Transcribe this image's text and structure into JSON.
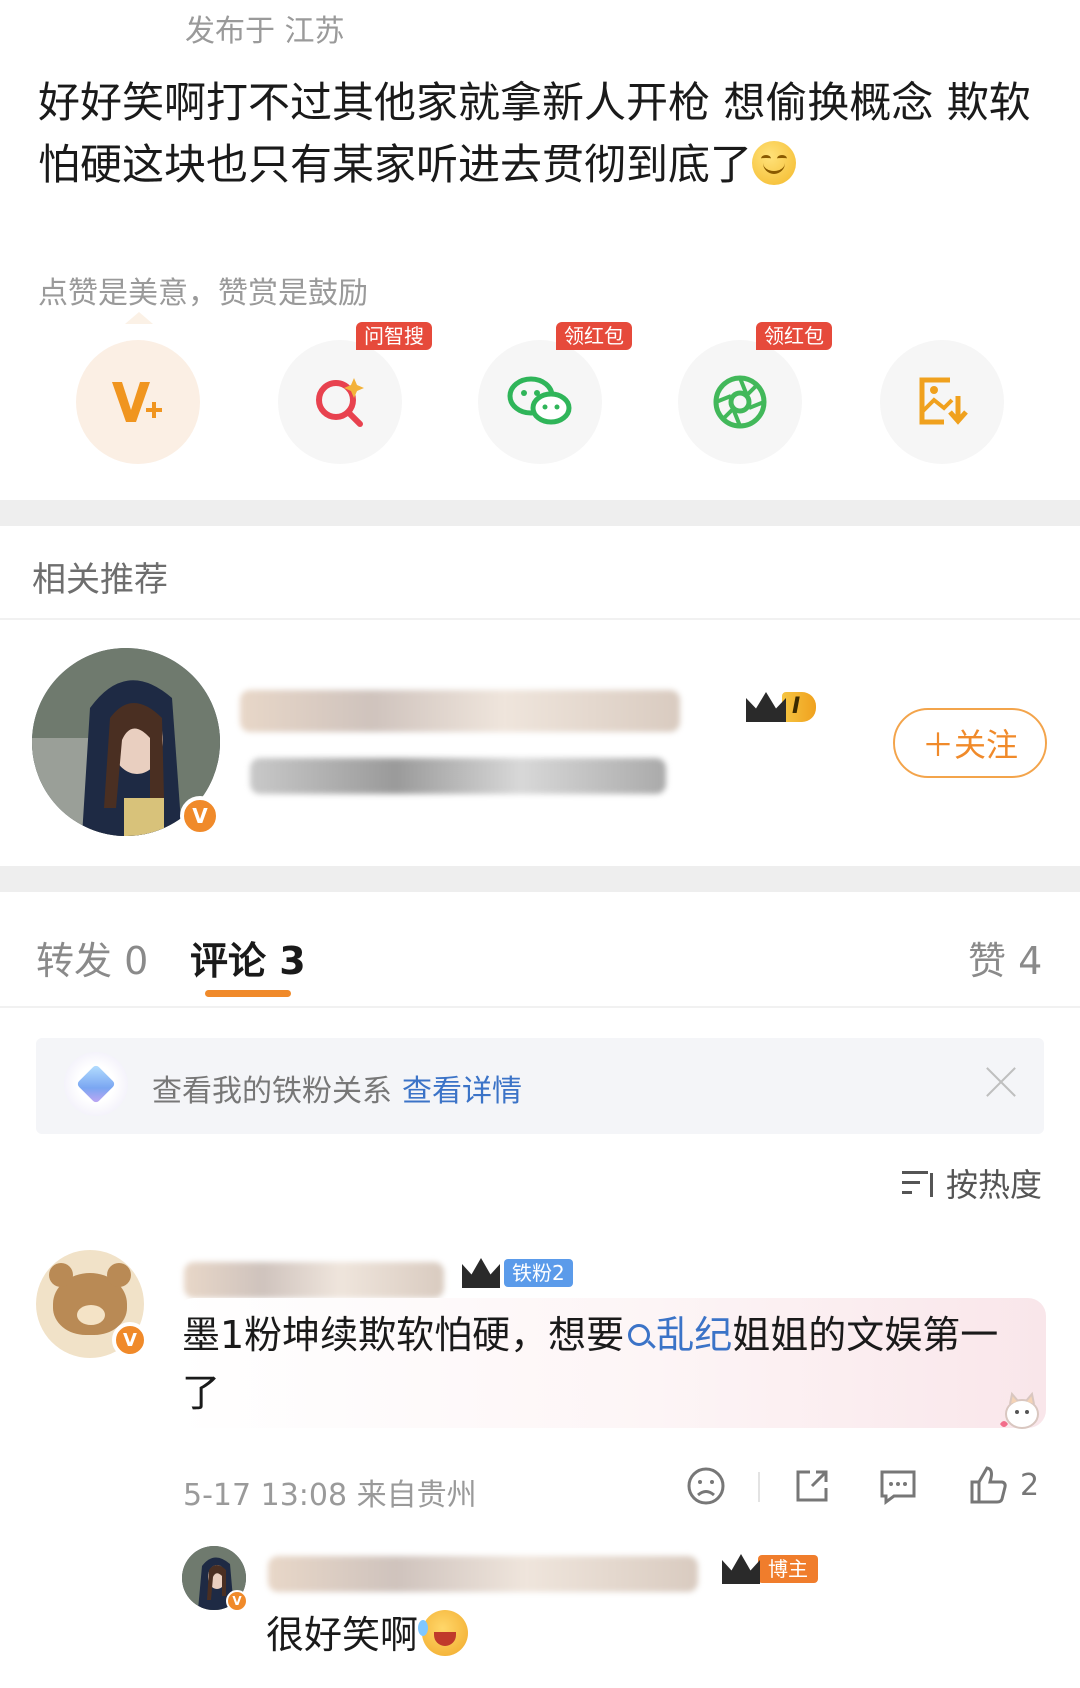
{
  "post": {
    "location": "发布于 江苏",
    "text": "好好笑啊打不过其他家就拿新人开枪 想偷换概念 欺软怕硬这块也只有某家听进去贯彻到底了",
    "reward_hint": "点赞是美意，赞赏是鼓励"
  },
  "actions": [
    {
      "icon": "v-plus-icon",
      "badge": ""
    },
    {
      "icon": "ai-search-icon",
      "badge": "问智搜"
    },
    {
      "icon": "wechat-icon",
      "badge": "领红包"
    },
    {
      "icon": "moments-icon",
      "badge": "领红包"
    },
    {
      "icon": "save-image-icon",
      "badge": ""
    }
  ],
  "related": {
    "title": "相关推荐",
    "user_level": "I",
    "follow_label": "＋关注"
  },
  "tabs": {
    "repost": "转发 0",
    "comments": "评论 3",
    "likes": "赞 4"
  },
  "fan_banner": {
    "text": "查看我的铁粉关系",
    "link": "查看详情"
  },
  "sort": {
    "label": "按热度"
  },
  "comment": {
    "fan_badge": "铁粉2",
    "text_before": "墨1粉坤续欺软怕硬，想要",
    "topic": "乱纪",
    "text_after": "姐姐的文娱第一了",
    "time_location": "5-17 13:08 来自贵州",
    "like_count": "2"
  },
  "reply": {
    "role_badge": "博主",
    "text": "很好笑啊"
  },
  "colors": {
    "accent": "#f08a2a",
    "link": "#3b73c7",
    "badge_red": "#e64a3b"
  }
}
